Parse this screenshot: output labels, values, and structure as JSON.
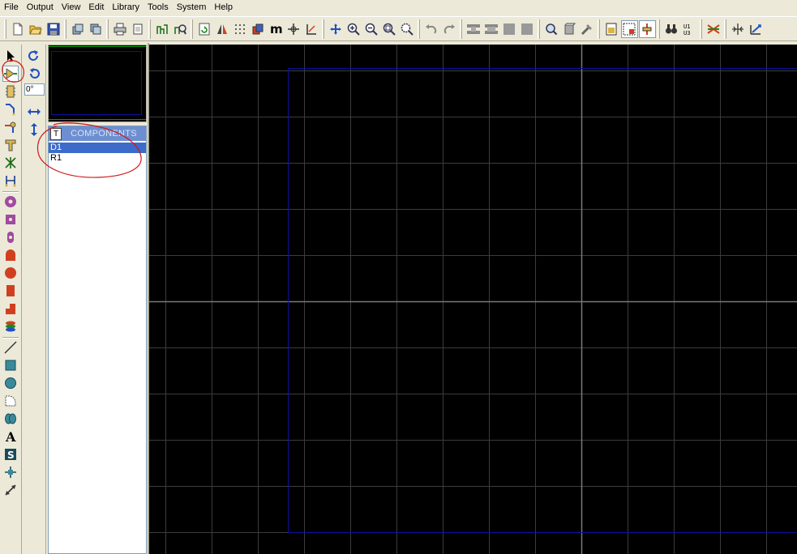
{
  "menu": {
    "items": [
      "File",
      "Output",
      "View",
      "Edit",
      "Library",
      "Tools",
      "System",
      "Help"
    ]
  },
  "toolbar": {
    "groups": [
      [
        "new-file-icon",
        "open-folder-icon",
        "save-icon"
      ],
      [
        "import-section-icon",
        "export-section-icon"
      ],
      [
        "print-icon",
        "print-area-icon"
      ],
      [
        "netlist-icon",
        "design-explorer-icon"
      ],
      [
        "refresh-icon",
        "flip-icon",
        "grid-icon",
        "layers-icon",
        "metric-icon",
        "origin-icon",
        "false-origin-icon",
        "pan-icon",
        "zoom-in-icon",
        "zoom-out-icon",
        "zoom-all-icon",
        "zoom-area-icon"
      ],
      [
        "undo-icon",
        "redo-icon"
      ],
      [
        "cut-icon",
        "copy-icon",
        "move-icon",
        "delete-icon"
      ],
      [
        "search-icon",
        "package-icon",
        "decompose-icon"
      ],
      [
        "page-icon",
        "autoplace-icon",
        "autorouter-icon"
      ],
      [
        "find-icon",
        "annotate-icon"
      ],
      [
        "ratsnest-icon"
      ],
      [
        "design-rule-icon",
        "power-icon"
      ]
    ]
  },
  "palette": {
    "tools": [
      "select-arrow-icon",
      "component-mode-icon",
      "package-mode-icon",
      "track-mode-icon",
      "via-mode-icon",
      "zone-mode-icon",
      "ratsnest-mode-icon",
      "connectivity-icon",
      "round-pad-icon",
      "square-pad-icon",
      "dil-pad-icon",
      "edge-pad-icon",
      "circular-smt-pad-icon",
      "rectangular-smt-pad-icon",
      "polygonal-pad-icon",
      "padstack-icon",
      "line-icon",
      "box-icon",
      "circle-icon",
      "arc-icon",
      "path-icon",
      "text-icon",
      "symbol-icon",
      "marker-icon",
      "dimension-icon"
    ],
    "active_index": 1
  },
  "rotation": {
    "angle_value": "0°",
    "tools": [
      "rotate-clockwise-icon",
      "rotate-anticlockwise-icon",
      "mirror-horizontal-icon",
      "mirror-vertical-icon"
    ]
  },
  "components": {
    "toggle_label": "T",
    "title": "COMPONENTS",
    "items": [
      "D1",
      "R1"
    ],
    "selected_index": 0
  },
  "colors": {
    "canvas_bg": "#000000",
    "grid_line": "#3c3c3c",
    "axis_line": "#7a7a7a",
    "board_edge": "#1010a0",
    "selection": "#3d6bc9",
    "panel_header": "#6d8fd1",
    "annotation": "#d01818"
  }
}
